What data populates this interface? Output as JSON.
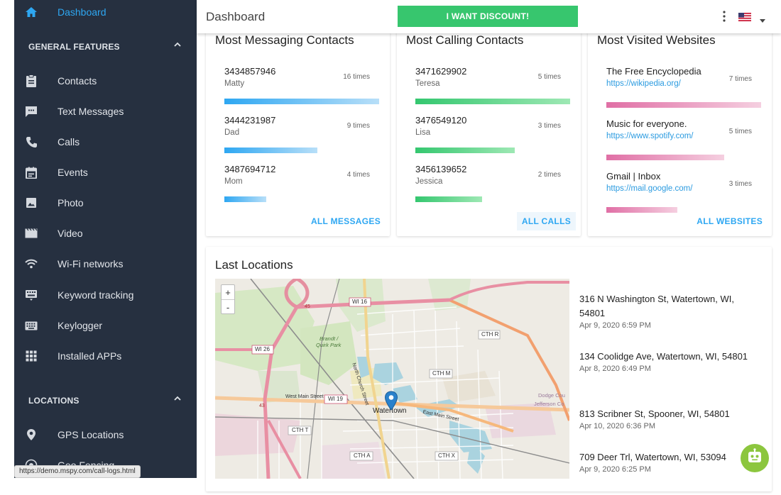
{
  "header": {
    "title": "Dashboard",
    "discount_label": "I WANT DISCOUNT!",
    "accent": "#37c66e"
  },
  "sidebar": {
    "active_item": "Dashboard",
    "section_general": "GENERAL FEATURES",
    "items": [
      {
        "label": "Contacts",
        "icon": "clipboard-icon"
      },
      {
        "label": "Text Messages",
        "icon": "message-icon"
      },
      {
        "label": "Calls",
        "icon": "phone-icon"
      },
      {
        "label": "Events",
        "icon": "calendar-icon"
      },
      {
        "label": "Photo",
        "icon": "image-icon"
      },
      {
        "label": "Video",
        "icon": "movie-icon"
      },
      {
        "label": "Wi-Fi networks",
        "icon": "wifi-icon"
      },
      {
        "label": "Keyword tracking",
        "icon": "keyword-icon"
      },
      {
        "label": "Keylogger",
        "icon": "keyboard-icon"
      },
      {
        "label": "Installed APPs",
        "icon": "apps-grid-icon"
      }
    ],
    "section_locations": "LOCATIONS",
    "location_items": [
      {
        "label": "GPS Locations",
        "icon": "map-pin-icon"
      },
      {
        "label": "Geo Fencing",
        "icon": "geofence-icon"
      }
    ]
  },
  "messaging": {
    "title": "Most Messaging Contacts",
    "action": "ALL MESSAGES",
    "rows": [
      {
        "number": "3434857946",
        "name": "Matty",
        "times": "16 times",
        "level": 1.0
      },
      {
        "number": "3444231987",
        "name": "Dad",
        "times": "9 times",
        "level": 0.6
      },
      {
        "number": "3487694712",
        "name": "Mom",
        "times": "4 times",
        "level": 0.27
      }
    ]
  },
  "calling": {
    "title": "Most Calling Contacts",
    "action": "ALL CALLS",
    "rows": [
      {
        "number": "3471629902",
        "name": "Teresa",
        "times": "5 times",
        "level": 1.0
      },
      {
        "number": "3476549120",
        "name": "Lisa",
        "times": "3 times",
        "level": 0.64
      },
      {
        "number": "3456139652",
        "name": "Jessica",
        "times": "2 times",
        "level": 0.43
      }
    ]
  },
  "websites": {
    "title": "Most Visited Websites",
    "action": "ALL WEBSITES",
    "rows": [
      {
        "title": "The Free Encyclopedia",
        "url": "https://wikipedia.org/",
        "times": "7 times",
        "level": 1.0
      },
      {
        "title": "Music for everyone.",
        "url": "https://www.spotify.com/",
        "times": "5 times",
        "level": 0.76
      },
      {
        "title": "Gmail | Inbox",
        "url": "https://mail.google.com/",
        "times": "3 times",
        "level": 0.46
      }
    ]
  },
  "locations": {
    "title": "Last Locations",
    "zoom_in": "+",
    "zoom_out": "-",
    "map_labels": {
      "wi16": "WI 16",
      "wi26": "WI 26",
      "wi19": "WI 19",
      "cthr": "CTH R",
      "cthm": "CTH M",
      "ctht": "CTH T",
      "ctha": "CTH A",
      "cthx": "CTH X",
      "brandt": "Brandt /",
      "quirk": "Quirk Park",
      "watertown": "Watertown",
      "westmain": "West Main Street",
      "eastmain": "East Main Street",
      "northchurch": "North Church Street",
      "dodge": "Dodge Cou",
      "jefferson": "Jefferson Co",
      "r45": "45",
      "r43": "43"
    },
    "items": [
      {
        "address": "316 N Washington St, Watertown, WI, 54801",
        "date": "Apr 9, 2020 6:59 PM"
      },
      {
        "address": "134 Coolidge Ave, Watertown, WI, 54801",
        "date": "Apr 8, 2020 6:49 PM"
      },
      {
        "address": "813 Scribner St, Spooner, WI, 54801",
        "date": "Apr 10, 2020 6:36 PM"
      },
      {
        "address": "709 Deer Trl, Watertown, WI, 53094",
        "date": "Apr 9, 2020 6:25 PM"
      }
    ]
  },
  "status_url": "https://demo.mspy.com/call-logs.html",
  "colors": {
    "sidebar_bg": "#263040",
    "accent_blue": "#2ea7f2",
    "messages_bar": "#2ea7f2",
    "calls_bar": "#34c76f",
    "websites_bar": "#e06fa5"
  }
}
